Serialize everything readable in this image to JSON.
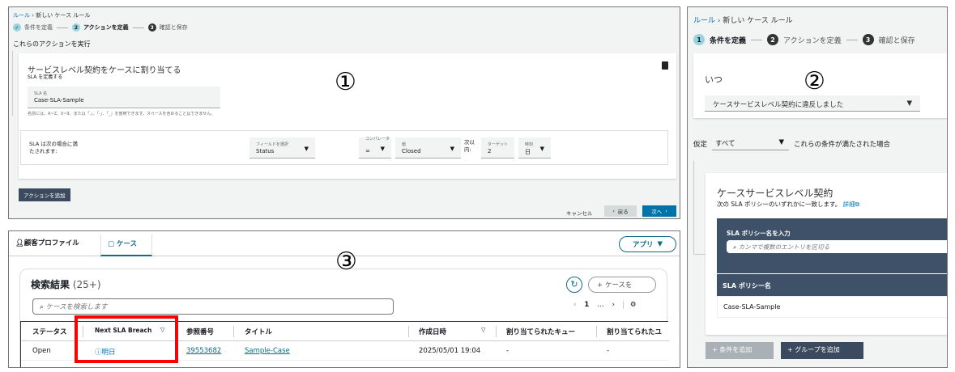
{
  "panel1": {
    "marker": "①",
    "breadcrumb": [
      "ルール",
      "新しい ケース ルール"
    ],
    "steps": [
      {
        "num": "✓",
        "label": "条件を定義",
        "state": "done"
      },
      {
        "num": "2",
        "label": "アクションを定義",
        "state": "current"
      },
      {
        "num": "3",
        "label": "確認と保存",
        "state": "upcoming"
      }
    ],
    "section_title": "これらのアクションを実行",
    "card_title": "サービスレベル契約をケースに割り当てる",
    "card_subtitle": "SLA を定義する",
    "sla_name_label": "SLA 名",
    "sla_name_value": "Case-SLA-Sample",
    "sla_name_hint": "名前には、A~Z、0~9、または「.」、「-」、「_」を使用できます。スペースを含めることはできません。",
    "condition_label": "SLA は次の場合に満たされます:",
    "field_label": "フィールドを選択",
    "field_value": "Status",
    "operator_label": "コンパレータ",
    "operator_value": "=",
    "value_label": "値",
    "value_value": "Closed",
    "within_label": "次以内:",
    "target_label": "ターゲット",
    "target_value": "2",
    "unit_label": "時刻",
    "unit_value": "日",
    "add_action": "アクションを追加",
    "cancel": "キャンセル",
    "back": "戻る",
    "next": "次へ"
  },
  "panel2": {
    "marker": "②",
    "breadcrumb": [
      "ルール",
      "新しい ケース ルール"
    ],
    "steps": [
      {
        "num": "1",
        "label": "条件を定義",
        "state": "current"
      },
      {
        "num": "2",
        "label": "アクションを定義",
        "state": "upcoming"
      },
      {
        "num": "3",
        "label": "確認と保存",
        "state": "upcoming"
      }
    ],
    "when_label": "いつ",
    "when_value": "ケースサービスレベル契約に違反しました",
    "assume_label": "仮定",
    "assume_value": "すべて",
    "assume_suffix": "これらの条件が満たされた場合",
    "sla_card_title": "ケースサービスレベル契約",
    "sla_card_desc": "次の SLA ポリシーのいずれかに一致します。",
    "details_link": "詳細",
    "policy_input_label": "SLA ポリシー名を入力",
    "policy_input_placeholder": "カンマで複数のエントリを区切る",
    "policy_column": "SLA ポリシー名",
    "policy_rows": [
      "Case-SLA-Sample"
    ],
    "add_condition": "条件を追加",
    "add_group": "グループを追加"
  },
  "panel3": {
    "marker": "③",
    "tabs": [
      {
        "label": "顧客プロファイル",
        "icon": "person-icon"
      },
      {
        "label": "ケース",
        "icon": "briefcase-icon",
        "active": true
      }
    ],
    "apps_button": "アプリ",
    "results_title": "検索結果",
    "results_count": "(25+)",
    "new_case_button": "ケースを",
    "search_placeholder": "ケースを検索します",
    "page": "1",
    "page_more": "...",
    "columns": [
      "ステータス",
      "Next SLA Breach",
      "参照番号",
      "タイトル",
      "作成日時",
      "割り当てられたキュー",
      "割り当てられたユ"
    ],
    "rows": [
      {
        "status": "Open",
        "next_sla_breach": "明日",
        "reference": "39553682",
        "title": "Sample-Case",
        "created": "2025/05/01 19:04",
        "queue": "-",
        "user": "-"
      }
    ],
    "highlight_color": "#ff0000"
  }
}
